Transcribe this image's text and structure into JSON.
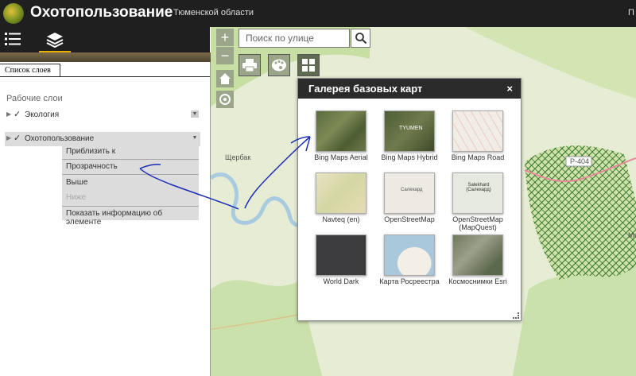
{
  "header": {
    "title": "Охотопользование",
    "region": "Тюменской области",
    "right_fragment": "П"
  },
  "panel": {
    "tab_label": "Список слоев",
    "section_title": "Рабочие слои",
    "layers": [
      {
        "label": "Экология",
        "checked": true
      },
      {
        "label": "Охотопользование",
        "checked": true
      }
    ],
    "context_menu": [
      "Приблизить к",
      "Прозрачность",
      "Выше",
      "Ниже",
      "Показать информацию об элементе"
    ]
  },
  "map": {
    "search_placeholder": "Поиск по улице",
    "labels": {
      "place": "Щербак",
      "road": "Р-404",
      "edge": "Мо"
    }
  },
  "gallery": {
    "title": "Галерея базовых карт",
    "close": "×",
    "items": [
      {
        "name": "Bing Maps Aerial"
      },
      {
        "name": "Bing Maps Hybrid",
        "thumb_text": "TYUMEN"
      },
      {
        "name": "Bing Maps Road"
      },
      {
        "name": "Navteq (en)"
      },
      {
        "name": "OpenStreetMap",
        "thumb_text": "Салехард"
      },
      {
        "name": "OpenStreetMap (MapQuest)",
        "thumb_text": "Salekhard (Салехард)"
      },
      {
        "name": "World Dark"
      },
      {
        "name": "Карта Росреестра"
      },
      {
        "name": "Космоснимки Esri"
      }
    ]
  },
  "colors": {
    "header_bg": "#1f1f1f",
    "accent": "#e8b100",
    "map_bg": "#e6edd4",
    "forest": "#b9d98f",
    "river": "#a9cbe0",
    "road": "#e8899a",
    "hatch": "#2d6b2d",
    "annotation": "#1a2db5"
  },
  "icons": [
    "list-icon",
    "layers-icon",
    "zoom-in-icon",
    "zoom-out-icon",
    "search-icon",
    "print-icon",
    "palette-icon",
    "grid-icon",
    "home-icon",
    "locate-icon",
    "close-icon",
    "resize-icon"
  ]
}
